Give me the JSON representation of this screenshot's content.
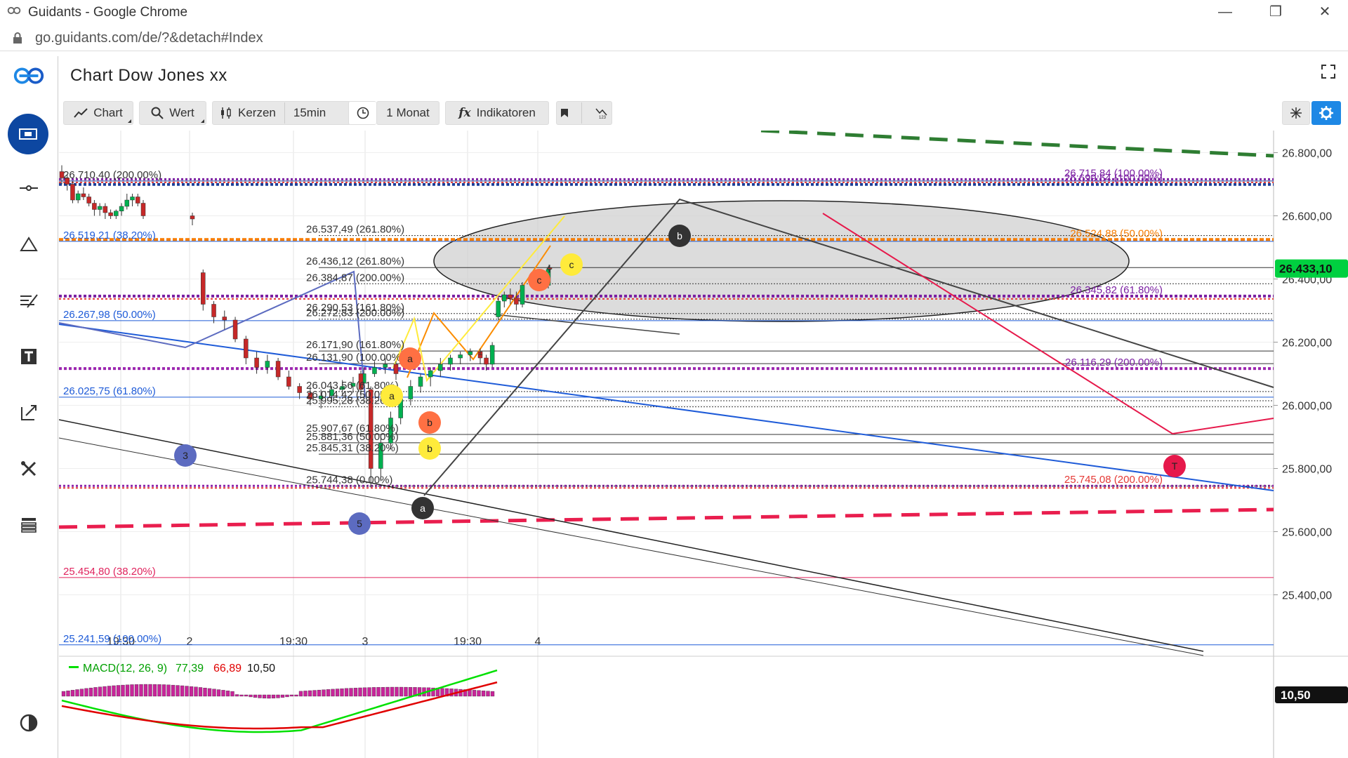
{
  "window": {
    "title": "Guidants - Google Chrome"
  },
  "browser": {
    "url": "go.guidants.com/de/?&detach#Index"
  },
  "header": {
    "title": "Chart Dow Jones xx"
  },
  "toolbar": {
    "chart": "Chart",
    "wert": "Wert",
    "kerzen": "Kerzen",
    "interval": "15min",
    "range": "1 Monat",
    "indikatoren": "Indikatoren"
  },
  "colors": {
    "brand_blue": "#1a5cc8",
    "accent_blue": "#1e88e5",
    "price_green": "#00b050",
    "macd_green": "#00e000",
    "macd_red": "#e00000",
    "hist_magenta": "#c8259a"
  },
  "icons": [
    "guidants-logo-icon",
    "portfolio-icon",
    "crosshair-icon",
    "triangle-icon",
    "trend-tools-icon",
    "text-icon",
    "edit-icon",
    "tools-icon",
    "list-icon",
    "contrast-icon",
    "clock-icon",
    "fx-icon",
    "bookmark-icon",
    "abc-icon",
    "sparkle-icon",
    "gear-icon",
    "expand-icon",
    "lock-icon"
  ],
  "chart_data": {
    "type": "candlestick",
    "y_axis": {
      "ticks": [
        "26.800,00",
        "26.600,00",
        "26.400,00",
        "26.200,00",
        "26.000,00",
        "25.800,00",
        "25.600,00",
        "25.400,00"
      ],
      "ylim": [
        25230,
        26870
      ]
    },
    "x_axis": {
      "ticks": [
        "19:30",
        "2",
        "19:30",
        "3",
        "19:30",
        "4"
      ]
    },
    "current_price": "26.433,10",
    "levels_left": [
      {
        "label": "26.710,40 (200.00%)",
        "value": 26710.4
      },
      {
        "label": "26.519,21 (38.20%)",
        "value": 26519.21
      },
      {
        "label": "26.267,98 (50.00%)",
        "value": 26267.98
      },
      {
        "label": "26.025,75 (61.80%)",
        "value": 26025.75
      },
      {
        "label": "25.454,80 (38.20%)",
        "value": 25454.8
      },
      {
        "label": "25.241,59 (100.00%)",
        "value": 25241.59
      }
    ],
    "levels_mid": [
      {
        "label": "26.537,49 (261.80%)",
        "value": 26537.49
      },
      {
        "label": "26.436,12 (261.80%)",
        "value": 26436.12
      },
      {
        "label": "26.384,87 (200.00%)",
        "value": 26384.87
      },
      {
        "label": "26.290,53 (161.80%)",
        "value": 26290.53
      },
      {
        "label": "26.272,83 (200.00%)",
        "value": 26272.83
      },
      {
        "label": "26.171,90 (161.80%)",
        "value": 26171.9
      },
      {
        "label": "26.131,90 (100.00%)",
        "value": 26131.9
      },
      {
        "label": "26.043,56 (61.80%)",
        "value": 26043.56
      },
      {
        "label": "26.014,42 (50.00%)",
        "value": 26014.42
      },
      {
        "label": "25.995,28 (38.20%)",
        "value": 25995.28
      },
      {
        "label": "25.907,67 (61.80%)",
        "value": 25907.67
      },
      {
        "label": "25.881,36 (50.00%)",
        "value": 25881.36
      },
      {
        "label": "25.845,31 (38.20%)",
        "value": 25845.31
      },
      {
        "label": "25.744,38 (0.00%)",
        "value": 25744.38
      }
    ],
    "levels_right": [
      {
        "label": "26.715,84 (100.00%)",
        "value": 26715.84
      },
      {
        "label": "26.699,54 (100.00%)",
        "value": 26699.54
      },
      {
        "label": "26.524,88 (50.00%)",
        "value": 26524.88
      },
      {
        "label": "26.345,82 (61.80%)",
        "value": 26345.82
      },
      {
        "label": "26.116,29 (200.00%)",
        "value": 26116.29
      },
      {
        "label": "25.745,08 (200.00%)",
        "value": 25745.08
      }
    ],
    "wave_labels": [
      "3",
      "5",
      "a",
      "b",
      "c",
      "a",
      "b",
      "c",
      "a",
      "b",
      "T"
    ],
    "candles": [
      [
        26740,
        26760,
        26700,
        26720
      ],
      [
        26720,
        26730,
        26680,
        26700
      ],
      [
        26700,
        26710,
        26640,
        26650
      ],
      [
        26650,
        26680,
        26640,
        26670
      ],
      [
        26670,
        26690,
        26650,
        26660
      ],
      [
        26660,
        26670,
        26630,
        26640
      ],
      [
        26640,
        26650,
        26600,
        26620
      ],
      [
        26620,
        26640,
        26600,
        26630
      ],
      [
        26630,
        26640,
        26590,
        26610
      ],
      [
        26610,
        26620,
        26590,
        26600
      ],
      [
        26600,
        26620,
        26590,
        26615
      ],
      [
        26615,
        26640,
        26600,
        26630
      ],
      [
        26630,
        26670,
        26620,
        26650
      ],
      [
        26650,
        26670,
        26630,
        26660
      ],
      [
        26660,
        26670,
        26630,
        26640
      ],
      [
        26640,
        26650,
        26590,
        26600
      ],
      [
        26600,
        26610,
        26570,
        26590
      ],
      [
        26420,
        26430,
        26300,
        26320
      ],
      [
        26320,
        26330,
        26260,
        26280
      ],
      [
        26280,
        26300,
        26240,
        26270
      ],
      [
        26270,
        26280,
        26200,
        26210
      ],
      [
        26210,
        26220,
        26130,
        26150
      ],
      [
        26150,
        26170,
        26100,
        26120
      ],
      [
        26120,
        26160,
        26100,
        26140
      ],
      [
        26140,
        26150,
        26080,
        26090
      ],
      [
        26090,
        26110,
        26050,
        26060
      ],
      [
        26060,
        26070,
        26020,
        26040
      ],
      [
        26040,
        26060,
        26000,
        26020
      ],
      [
        26020,
        26050,
        25990,
        26030
      ],
      [
        26030,
        26060,
        26010,
        26050
      ],
      [
        26050,
        26080,
        26030,
        26060
      ],
      [
        26060,
        26090,
        26040,
        26070
      ],
      [
        26070,
        26120,
        26060,
        26100
      ],
      [
        26100,
        26140,
        26090,
        26120
      ],
      [
        26120,
        26150,
        26100,
        26130
      ],
      [
        26130,
        26140,
        26080,
        26100
      ],
      [
        26100,
        26110,
        26030,
        26050
      ],
      [
        26050,
        26060,
        25740,
        25800
      ],
      [
        25800,
        25900,
        25760,
        25880
      ],
      [
        25880,
        25980,
        25860,
        25960
      ],
      [
        25960,
        26040,
        25940,
        26020
      ],
      [
        26020,
        26080,
        26000,
        26060
      ],
      [
        26060,
        26100,
        26040,
        26090
      ],
      [
        26090,
        26120,
        26060,
        26110
      ],
      [
        26110,
        26150,
        26090,
        26130
      ],
      [
        26130,
        26160,
        26110,
        26150
      ],
      [
        26150,
        26170,
        26130,
        26160
      ],
      [
        26160,
        26180,
        26140,
        26170
      ],
      [
        26170,
        26180,
        26150,
        26160
      ],
      [
        26160,
        26170,
        26130,
        26150
      ],
      [
        26150,
        26160,
        26110,
        26130
      ],
      [
        26130,
        26200,
        26120,
        26190
      ],
      [
        26280,
        26340,
        26270,
        26330
      ],
      [
        26330,
        26360,
        26310,
        26350
      ],
      [
        26350,
        26370,
        26320,
        26340
      ],
      [
        26340,
        26360,
        26300,
        26320
      ],
      [
        26320,
        26390,
        26310,
        26380
      ],
      [
        26380,
        26440,
        26370,
        26430
      ],
      [
        26430,
        26445,
        26420,
        26435
      ],
      [
        26435,
        26445,
        26420,
        26433
      ]
    ],
    "macd": {
      "label": "MACD(12, 26, 9)",
      "macd": "77,39",
      "signal": "66,89",
      "hist": "10,50",
      "current": "10,50"
    }
  }
}
